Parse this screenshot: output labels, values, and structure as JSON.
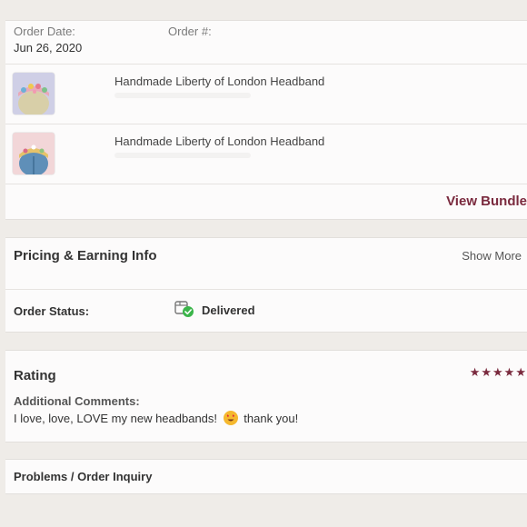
{
  "order": {
    "date_label": "Order Date:",
    "date_value": "Jun 26, 2020",
    "number_label": "Order #:",
    "items": [
      {
        "title": "Handmade Liberty of London Headband",
        "thumb_icon": "headband-photo-floral"
      },
      {
        "title": "Handmade Liberty of London Headband",
        "thumb_icon": "headband-photo-blue"
      }
    ],
    "view_bundle": "View Bundle"
  },
  "pricing": {
    "title": "Pricing & Earning Info",
    "show_more": "Show More",
    "status_label": "Order Status:",
    "status_value": "Delivered",
    "status_icon": "delivered-box-check-icon"
  },
  "rating": {
    "title": "Rating",
    "stars": "★★★★★",
    "stars_value": 5,
    "comments_label": "Additional Comments:",
    "comment_before": "I love, love, LOVE my new headbands!",
    "comment_emoji": "heart-eyes-emoji",
    "comment_after": "thank you!"
  },
  "problems": {
    "title": "Problems / Order Inquiry"
  },
  "colors": {
    "accent": "#7a2a3e",
    "background": "#efece8",
    "card": "#fcfbfb",
    "delivered_green": "#3bb54a"
  }
}
